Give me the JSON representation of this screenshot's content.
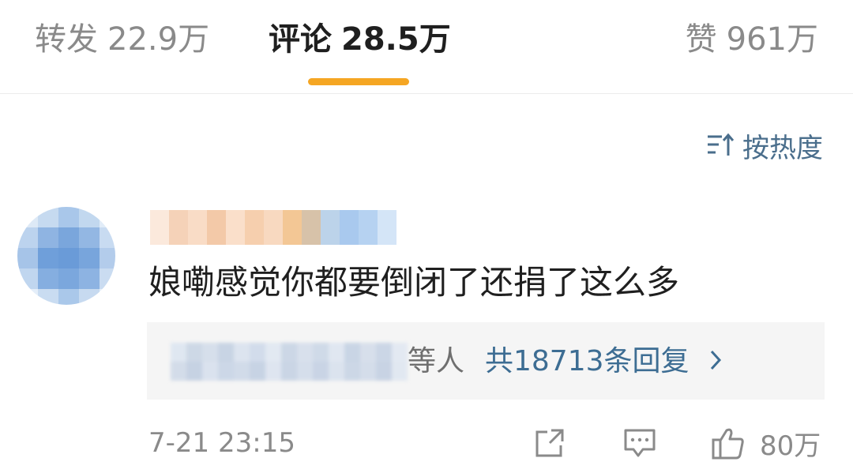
{
  "tabs": [
    {
      "label": "转发",
      "count": "22.9万"
    },
    {
      "label": "评论",
      "count": "28.5万"
    },
    {
      "label": "赞",
      "count": "961万"
    }
  ],
  "active_tab_color": "#f5a623",
  "sort": {
    "label": "按热度",
    "icon": "sort-icon"
  },
  "comment": {
    "text": "娘嘞感觉你都要倒闭了还捐了这么多",
    "timestamp": "7-21 23:15",
    "replies": {
      "etc_label": "等人",
      "total_label": "共18713条回复"
    },
    "likes": "80万",
    "icons": [
      "share-icon",
      "comment-icon",
      "like-icon",
      "chevron-right-icon"
    ]
  },
  "colors": {
    "link": "#3d6d93",
    "muted": "#8a8a8a",
    "text": "#1f1f1f"
  }
}
